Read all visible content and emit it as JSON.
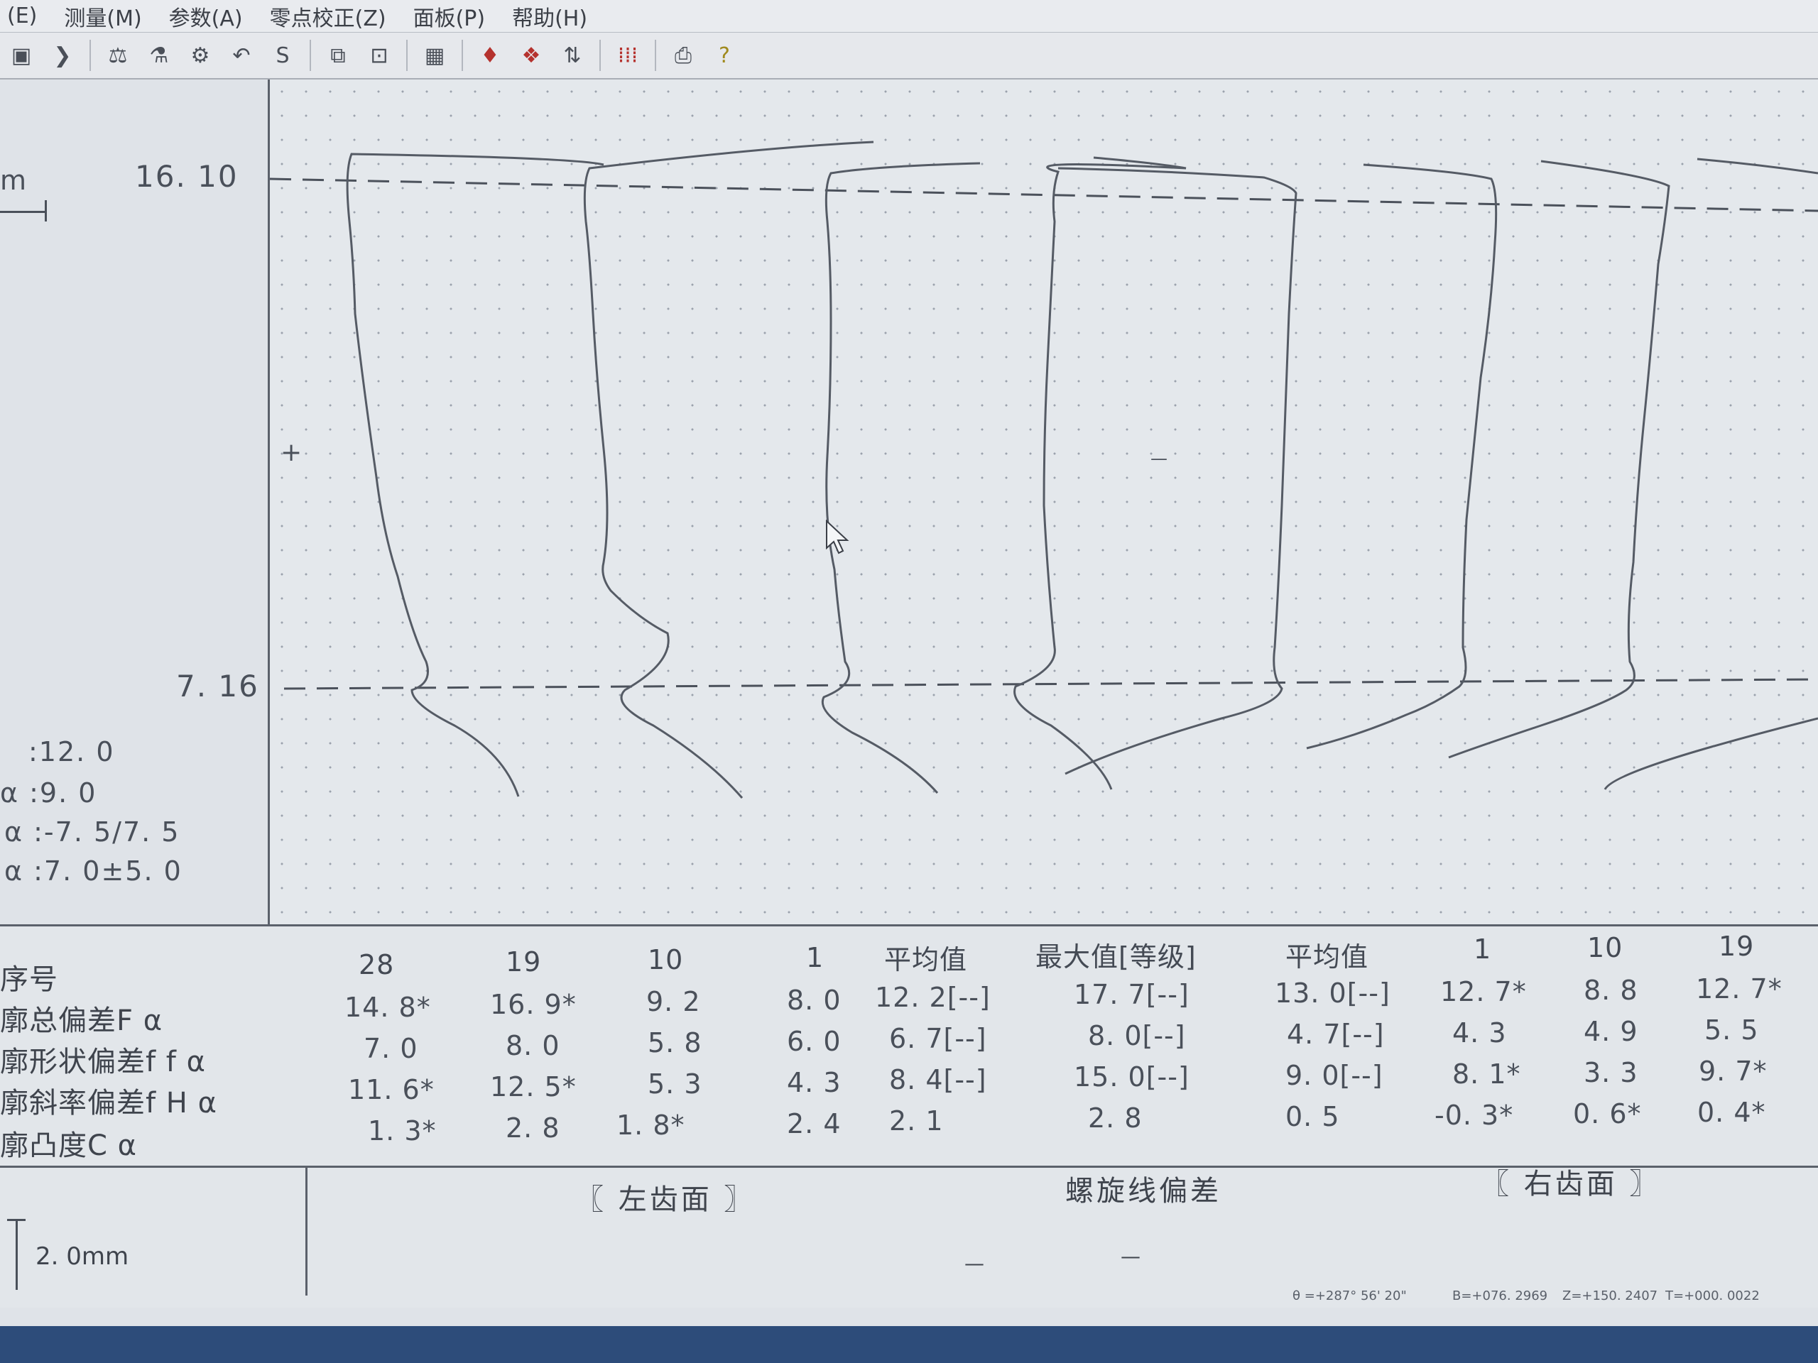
{
  "menu": [
    "(E)",
    "测量(M)",
    "参数(A)",
    "零点校正(Z)",
    "面板(P)",
    "帮助(H)"
  ],
  "toolbar_icons": [
    "save-icon",
    "doc-icon",
    "measure-a-icon",
    "measure-b-icon",
    "measure-c-icon",
    "undo-icon",
    "redo-icon",
    "window-icon",
    "window2-icon",
    "grid-icon",
    "marker-icon",
    "marker2-icon",
    "axis-icon",
    "dots-icon",
    "print-icon",
    "help-icon"
  ],
  "left_panel": {
    "unit": "m",
    "upper_value": "16. 10",
    "lower_value": "7. 16",
    "params": [
      ":12. 0",
      "α :9. 0",
      "α :-7. 5/7. 5",
      "α :7. 0±5. 0"
    ]
  },
  "plot": {
    "plus_mark": "+",
    "minus_mark": "—"
  },
  "table": {
    "headers": [
      "序号",
      "28",
      "19",
      "10",
      "1",
      "平均值",
      "最大值[等级]",
      "平均值",
      "1",
      "10",
      "19"
    ],
    "rows": [
      {
        "label": "廓总偏差F α",
        "values": [
          "14. 8*",
          "16. 9*",
          "9. 2",
          "8. 0",
          "12. 2[--]",
          "17. 7[--]",
          "13. 0[--]",
          "12. 7*",
          "8. 8",
          "12. 7*"
        ]
      },
      {
        "label": "廓形状偏差f f α",
        "values": [
          "7. 0",
          "8. 0",
          "5. 8",
          "6. 0",
          "6. 7[--]",
          "8. 0[--]",
          "4. 7[--]",
          "4. 3",
          "4. 9",
          "5. 5"
        ]
      },
      {
        "label": "廓斜率偏差f H α",
        "values": [
          "11. 6*",
          "12. 5*",
          "5. 3",
          "4. 3",
          "8. 4[--]",
          "15. 0[--]",
          "9. 0[--]",
          "8. 1*",
          "3. 3",
          "9. 7*"
        ]
      },
      {
        "label": "廓凸度C α",
        "values": [
          "1. 3*",
          "2. 8",
          "1. 8*",
          "2. 4",
          "2. 1",
          "2. 8",
          "0. 5",
          "-0. 3*",
          "0. 6*",
          "0. 4*"
        ]
      }
    ]
  },
  "footer": {
    "left_face": "〖 左齿面 〗",
    "center": "螺旋线偏差",
    "right_face": "〖 右齿面 〗",
    "scale": "2. 0mm",
    "marks": [
      "—",
      "—"
    ]
  },
  "status": [
    "θ =+287° 56' 20\"",
    "B=+076. 2969",
    "Z=+150. 2407",
    "T=+000. 0022"
  ]
}
